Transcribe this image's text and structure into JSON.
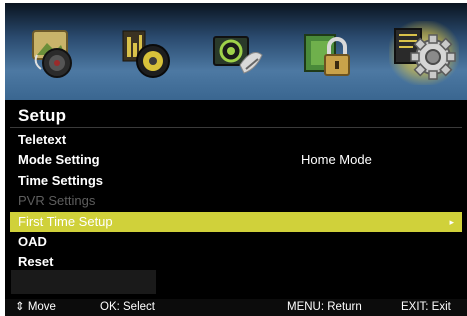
{
  "top_icons": [
    {
      "name": "picture-icon",
      "active": false
    },
    {
      "name": "sound-icon",
      "active": false
    },
    {
      "name": "channel-icon",
      "active": false
    },
    {
      "name": "lock-icon",
      "active": false
    },
    {
      "name": "setup-gear-icon",
      "active": true
    }
  ],
  "menu": {
    "title": "Setup",
    "items": [
      {
        "label": "Teletext",
        "value": "",
        "state": "normal"
      },
      {
        "label": "Mode Setting",
        "value": "Home Mode",
        "state": "normal"
      },
      {
        "label": "Time Settings",
        "value": "",
        "state": "normal"
      },
      {
        "label": "PVR Settings",
        "value": "",
        "state": "disabled"
      },
      {
        "label": "First Time Setup",
        "value": "",
        "state": "selected"
      },
      {
        "label": "OAD",
        "value": "",
        "state": "normal"
      },
      {
        "label": "Reset",
        "value": "",
        "state": "normal"
      }
    ],
    "selected_arrow": "▸"
  },
  "footer": {
    "move": "⇕ Move",
    "ok": "OK: Select",
    "menu": "MENU: Return",
    "exit": "EXIT: Exit"
  },
  "colors": {
    "highlight": "#d0d13a",
    "background": "#000000",
    "disabled_text": "#5e5e5e",
    "icon_bar": "#4d79a3"
  }
}
